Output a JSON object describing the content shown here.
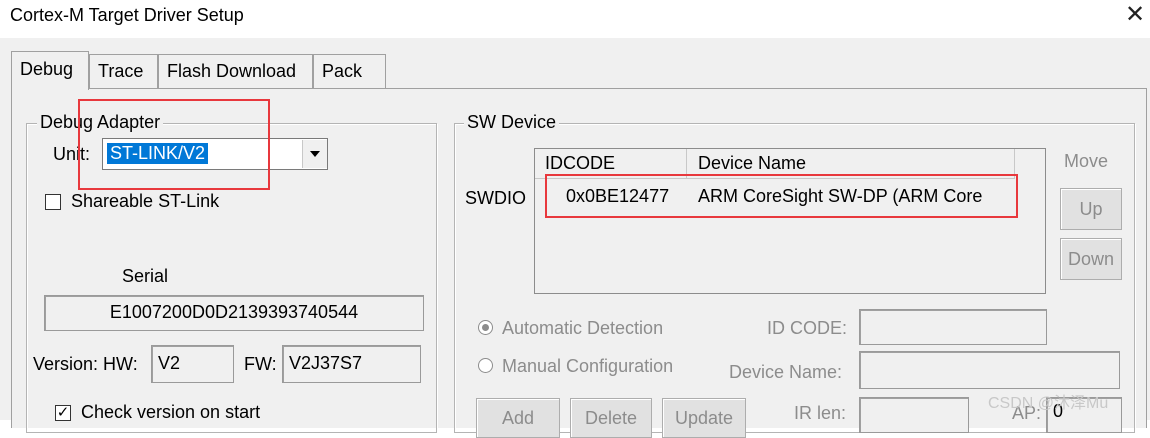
{
  "window": {
    "title": "Cortex-M Target Driver Setup",
    "close_glyph": "✕"
  },
  "tabs": [
    {
      "label": "Debug",
      "active": true
    },
    {
      "label": "Trace"
    },
    {
      "label": "Flash Download"
    },
    {
      "label": "Pack"
    }
  ],
  "debug_adapter": {
    "legend": "Debug Adapter",
    "unit_label": "Unit:",
    "unit_value": "ST-LINK/V2",
    "shareable_label": "Shareable ST-Link",
    "shareable_checked": false,
    "serial_label": "Serial",
    "serial_value": "E1007200D0D2139393740544",
    "version_label": "Version: HW:",
    "hw_value": "V2",
    "fw_label": "FW:",
    "fw_value": "V2J37S7",
    "check_version_label": "Check version on start",
    "check_version_checked": true,
    "check_glyph": "✓"
  },
  "sw_device": {
    "legend": "SW Device",
    "row_label": "SWDIO",
    "columns": [
      "IDCODE",
      "Device Name"
    ],
    "rows": [
      {
        "idcode": "0x0BE12477",
        "device_name": "ARM CoreSight SW-DP (ARM Core"
      }
    ],
    "move_label": "Move",
    "up_label": "Up",
    "down_label": "Down",
    "automatic_label": "Automatic Detection",
    "manual_label": "Manual Configuration",
    "id_code_label": "ID CODE:",
    "device_name_label": "Device Name:",
    "ir_len_label": "IR len:",
    "ap_label": "AP:",
    "ap_value": "0",
    "add_label": "Add",
    "delete_label": "Delete",
    "update_label": "Update",
    "selected_mode": "automatic"
  },
  "watermark": "CSDN @沐泽Mu",
  "colors": {
    "highlight_box": "#e8383d",
    "selection": "#0078d7",
    "dialog_bg": "#f0f0f0"
  },
  "icons": {
    "dropdown": "chevron-down-icon",
    "close": "close-icon"
  }
}
